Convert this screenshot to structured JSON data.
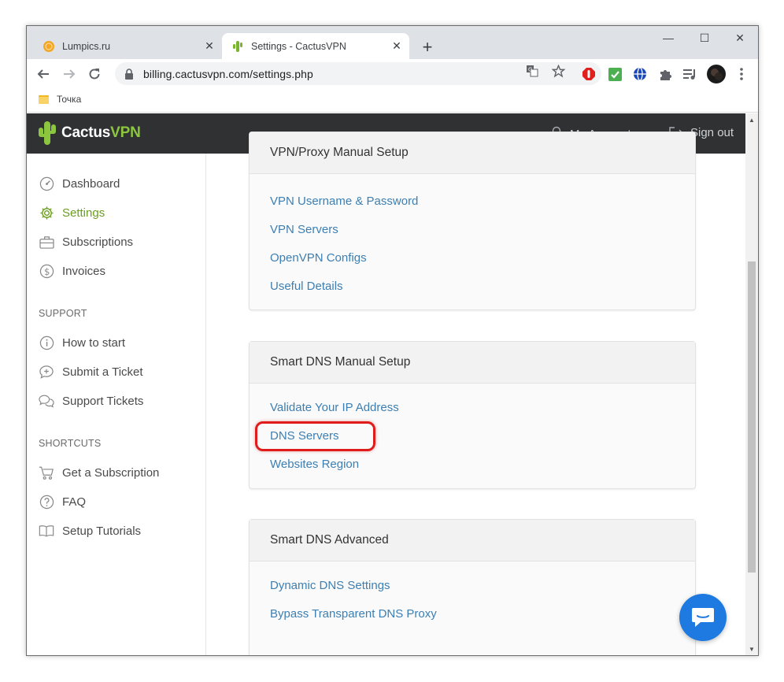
{
  "browser": {
    "tabs": [
      {
        "title": "Lumpics.ru",
        "active": false,
        "favicon": "orange-circle-icon"
      },
      {
        "title": "Settings - CactusVPN",
        "active": true,
        "favicon": "cactus-icon"
      }
    ],
    "new_tab_label": "+",
    "window_controls": {
      "minimize": "—",
      "maximize": "☐",
      "close": "✕"
    },
    "address": "billing.cactusvpn.com/settings.php",
    "bookmarks": [
      {
        "label": "Точка"
      }
    ]
  },
  "site": {
    "brand": {
      "name_part1": "Cactus",
      "name_part2": "VPN"
    },
    "header": {
      "account": "My Account",
      "signout": "Sign out"
    },
    "sidebar": {
      "main": [
        {
          "label": "Dashboard",
          "icon": "dashboard-icon"
        },
        {
          "label": "Settings",
          "icon": "gear-icon",
          "active": true
        },
        {
          "label": "Subscriptions",
          "icon": "briefcase-icon"
        },
        {
          "label": "Invoices",
          "icon": "dollar-icon"
        }
      ],
      "support_heading": "SUPPORT",
      "support": [
        {
          "label": "How to start",
          "icon": "info-icon"
        },
        {
          "label": "Submit a Ticket",
          "icon": "chat-plus-icon"
        },
        {
          "label": "Support Tickets",
          "icon": "chats-icon"
        }
      ],
      "shortcuts_heading": "SHORTCUTS",
      "shortcuts": [
        {
          "label": "Get a Subscription",
          "icon": "cart-icon"
        },
        {
          "label": "FAQ",
          "icon": "question-icon"
        },
        {
          "label": "Setup Tutorials",
          "icon": "book-icon"
        }
      ]
    },
    "cards": [
      {
        "title": "VPN/Proxy Manual Setup",
        "links": [
          "VPN Username & Password",
          "VPN Servers",
          "OpenVPN Configs",
          "Useful Details"
        ]
      },
      {
        "title": "Smart DNS Manual Setup",
        "links": [
          "Validate Your IP Address",
          "DNS Servers",
          "Websites Region"
        ]
      },
      {
        "title": "Smart DNS Advanced",
        "links": [
          "Dynamic DNS Settings",
          "Bypass Transparent DNS Proxy"
        ]
      }
    ]
  },
  "colors": {
    "accent": "#8cc63f",
    "link": "#3d7fb2",
    "highlight": "#e01b1b",
    "header_bg": "#2f3133",
    "chat": "#1e7ae0"
  }
}
